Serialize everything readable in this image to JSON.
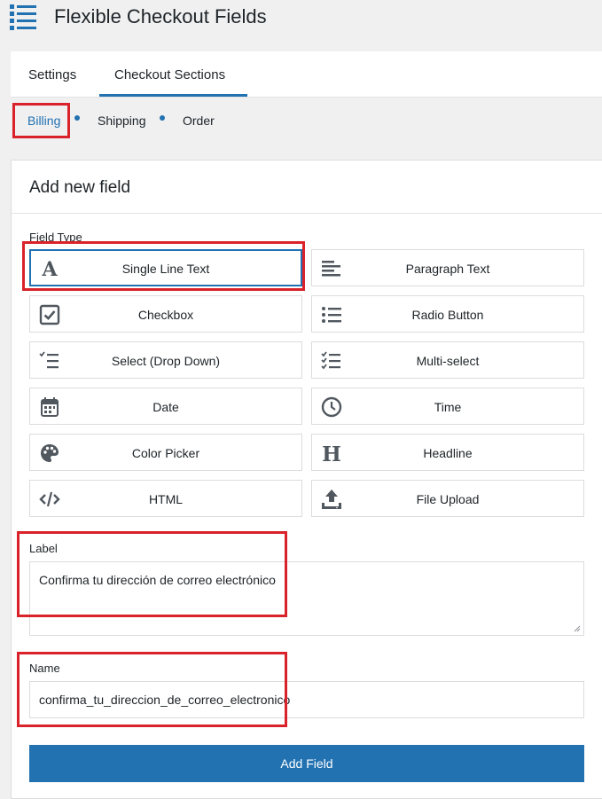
{
  "header": {
    "title": "Flexible Checkout Fields",
    "menu_icon": "list-icon"
  },
  "tabs": [
    {
      "label": "Settings",
      "active": false
    },
    {
      "label": "Checkout Sections",
      "active": true
    }
  ],
  "sections": [
    {
      "label": "Billing",
      "active": true
    },
    {
      "label": "Shipping",
      "active": false
    },
    {
      "label": "Order",
      "active": false
    }
  ],
  "panel": {
    "title": "Add new field",
    "field_type_label": "Field Type",
    "field_types": [
      {
        "label": "Single Line Text",
        "icon": "letter-a-icon",
        "selected": true
      },
      {
        "label": "Paragraph Text",
        "icon": "paragraph-lines-icon",
        "selected": false
      },
      {
        "label": "Checkbox",
        "icon": "checkbox-icon",
        "selected": false
      },
      {
        "label": "Radio Button",
        "icon": "bullet-list-icon",
        "selected": false
      },
      {
        "label": "Select (Drop Down)",
        "icon": "select-list-icon",
        "selected": false
      },
      {
        "label": "Multi-select",
        "icon": "checklist-icon",
        "selected": false
      },
      {
        "label": "Date",
        "icon": "calendar-icon",
        "selected": false
      },
      {
        "label": "Time",
        "icon": "clock-icon",
        "selected": false
      },
      {
        "label": "Color Picker",
        "icon": "palette-icon",
        "selected": false
      },
      {
        "label": "Headline",
        "icon": "heading-h-icon",
        "selected": false
      },
      {
        "label": "HTML",
        "icon": "code-icon",
        "selected": false
      },
      {
        "label": "File Upload",
        "icon": "upload-icon",
        "selected": false
      }
    ],
    "label_label": "Label",
    "label_value": "Confirma tu dirección de correo electrónico",
    "name_label": "Name",
    "name_value": "confirma_tu_direccion_de_correo_electronico",
    "add_button": "Add Field"
  },
  "colors": {
    "accent": "#2271b1",
    "highlight_box": "#d9222a",
    "background": "#f0f0f1",
    "icon": "#50575e"
  }
}
